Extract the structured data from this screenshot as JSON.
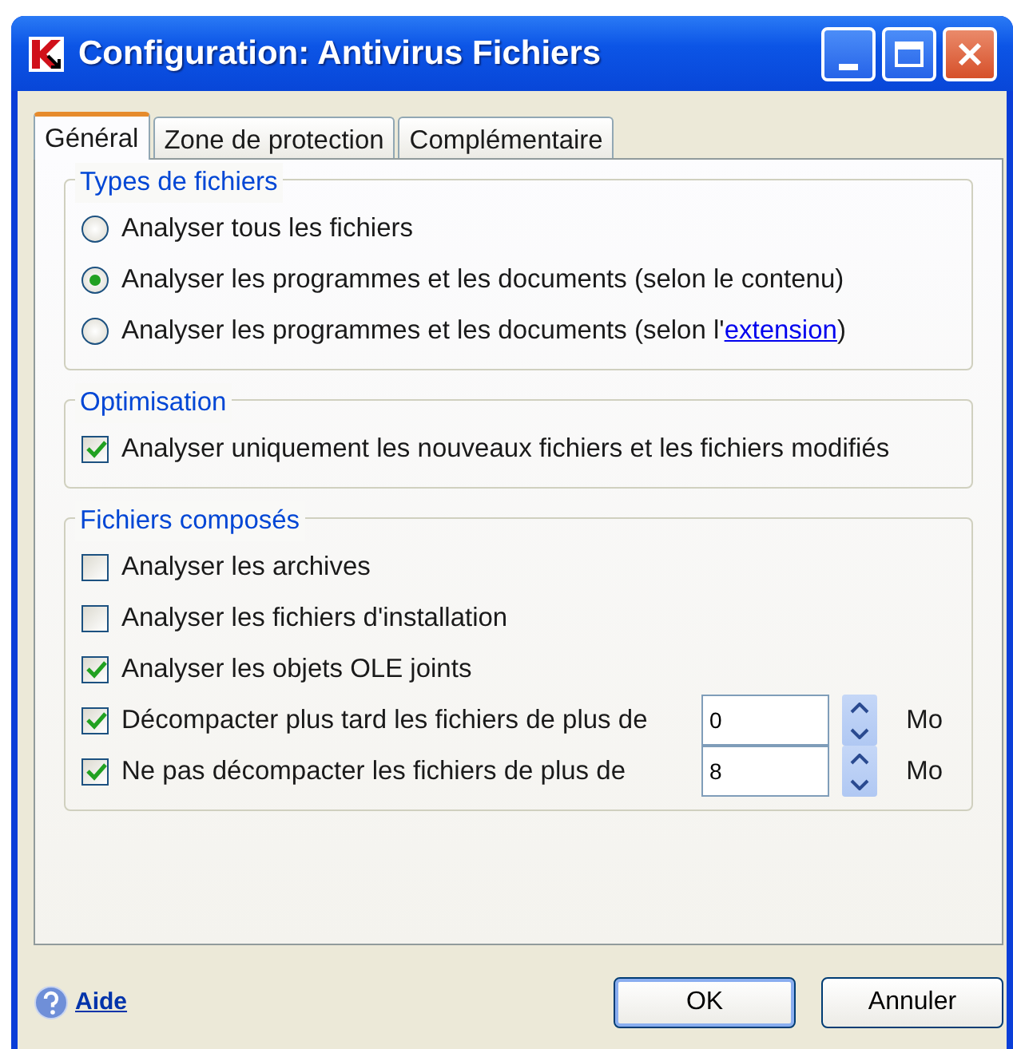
{
  "window": {
    "title": "Configuration: Antivirus Fichiers"
  },
  "tabs": [
    {
      "label": "Général",
      "selected": true
    },
    {
      "label": "Zone de protection",
      "selected": false
    },
    {
      "label": "Complémentaire",
      "selected": false
    }
  ],
  "groups": [
    {
      "title": "Types de fichiers",
      "items": [
        {
          "kind": "radio",
          "label": "Analyser tous les fichiers",
          "selected": false
        },
        {
          "kind": "radio",
          "label": "Analyser les programmes et les documents (selon le contenu)",
          "selected": true
        },
        {
          "kind": "radio",
          "label": "Analyser les programmes et les documents (selon l'",
          "link": "extension",
          "after": ")",
          "selected": false
        }
      ]
    },
    {
      "title": "Optimisation",
      "items": [
        {
          "kind": "checkbox",
          "label": "Analyser uniquement les nouveaux fichiers et les fichiers modifiés",
          "checked": true
        }
      ]
    },
    {
      "title": "Fichiers composés",
      "items": [
        {
          "kind": "checkbox",
          "label": "Analyser les archives",
          "checked": false
        },
        {
          "kind": "checkbox",
          "label": "Analyser les fichiers d'installation",
          "checked": false
        },
        {
          "kind": "checkbox",
          "label": "Analyser les objets OLE joints",
          "checked": true
        },
        {
          "kind": "spin",
          "label": "Décompacter plus tard les fichiers de plus de",
          "checked": true,
          "value": "0",
          "unit": "Mo"
        },
        {
          "kind": "spin",
          "label": "Ne pas décompacter les fichiers de plus de",
          "checked": true,
          "value": "8",
          "unit": "Mo"
        }
      ]
    }
  ],
  "footer": {
    "help": "Aide",
    "buttons": [
      "OK",
      "Annuler"
    ]
  }
}
